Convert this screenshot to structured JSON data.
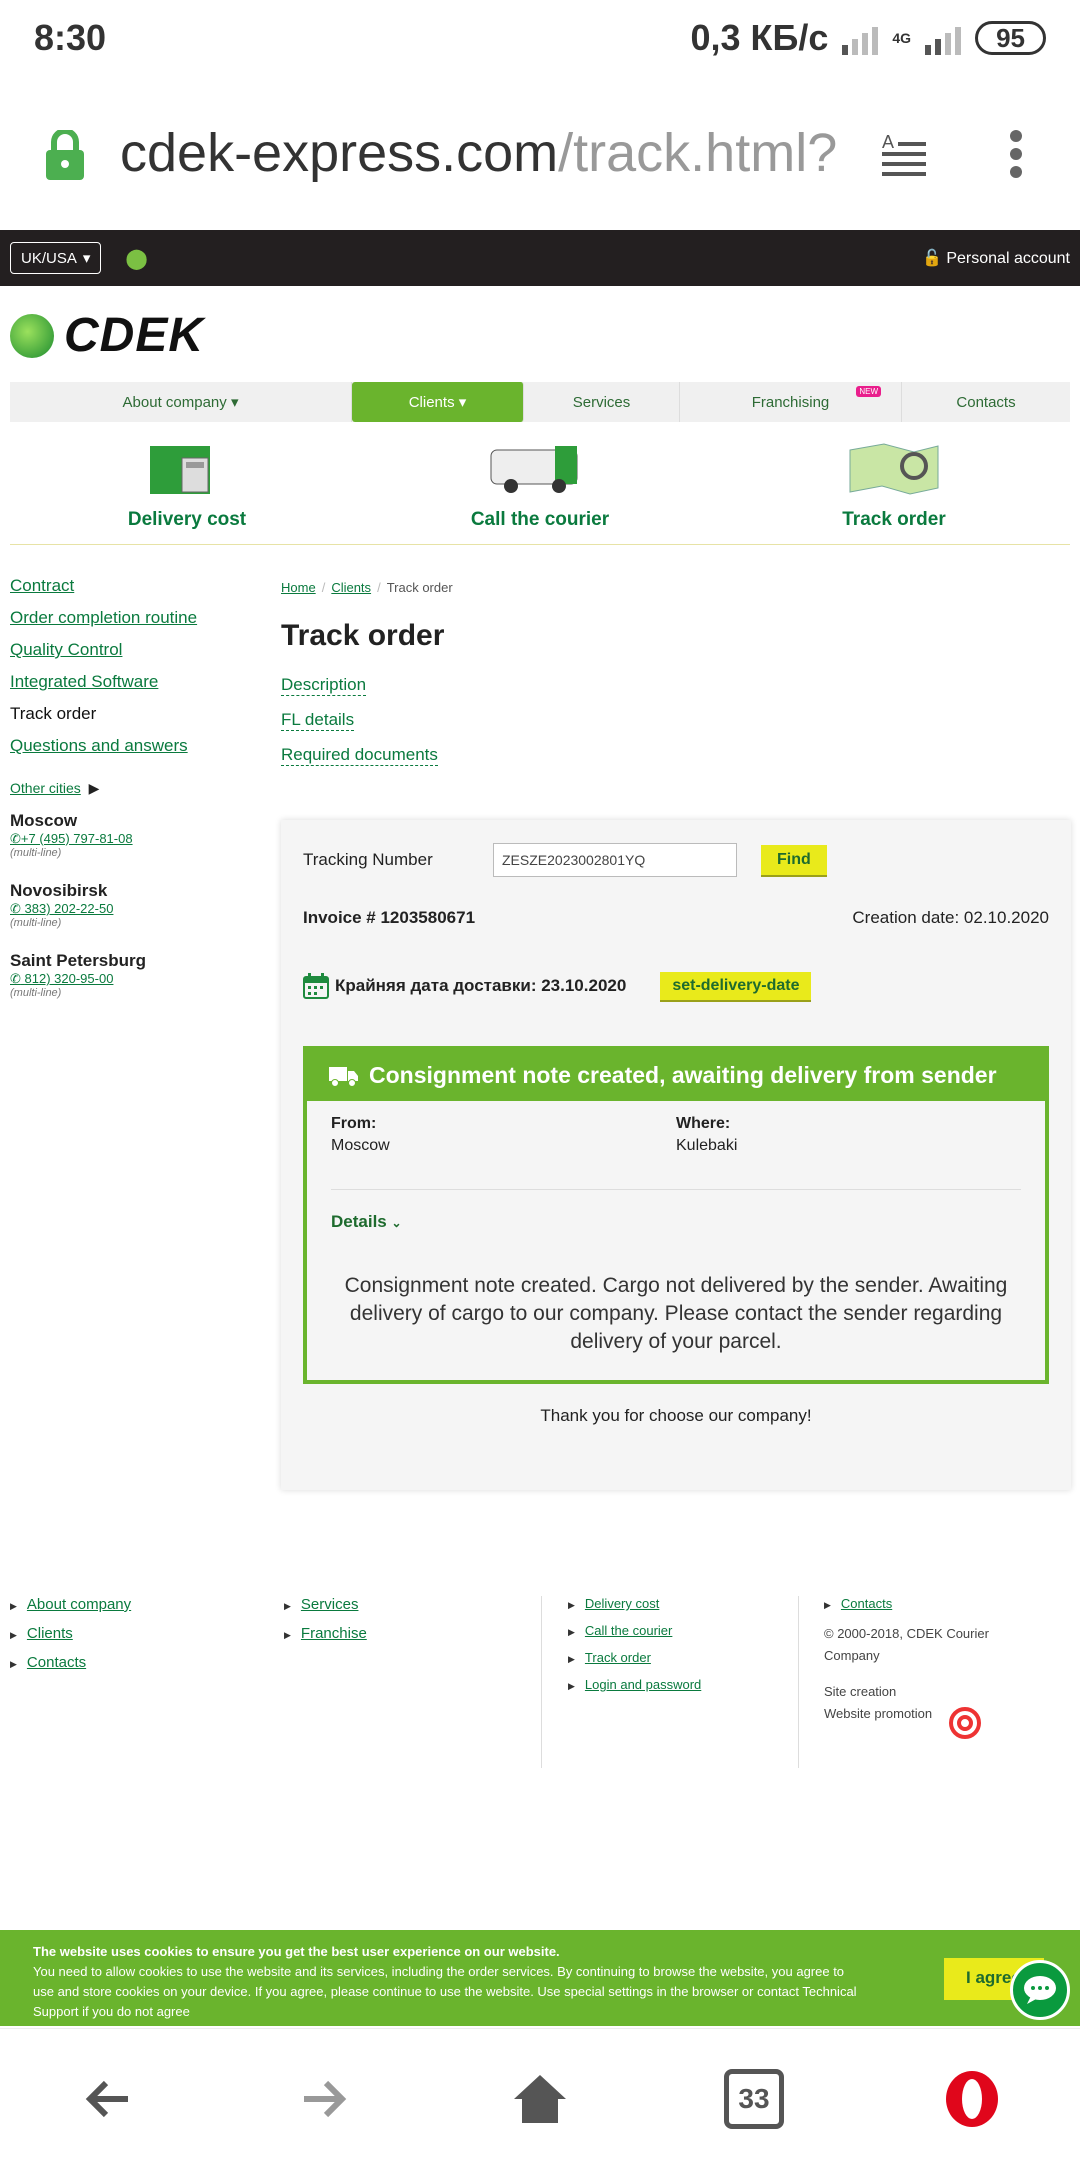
{
  "status_bar": {
    "time": "8:30",
    "speed": "0,3 КБ/с",
    "network": "4G",
    "battery": "95"
  },
  "browser": {
    "url_main": "cdek-express.com",
    "url_path": "/track.html?",
    "tab_count": "33"
  },
  "topbar": {
    "region": "UK/USA",
    "account": "Personal account"
  },
  "logo": {
    "text": "CDEK"
  },
  "mainnav": [
    {
      "label": "About company",
      "active": false
    },
    {
      "label": "Clients",
      "active": true
    },
    {
      "label": "Services",
      "active": false
    },
    {
      "label": "Franchising",
      "active": false,
      "badge": "NEW"
    },
    {
      "label": "Contacts",
      "active": false
    }
  ],
  "quicklinks": [
    "Delivery cost",
    "Call the courier",
    "Track order"
  ],
  "sidebar": {
    "links": [
      "Contract",
      "Order completion routine",
      "Quality Control",
      "Integrated Software",
      "Track order",
      "Questions and answers"
    ],
    "other_cities": "Other cities",
    "cities": [
      {
        "name": "Moscow",
        "phone": "+7 (495) 797-81-08",
        "note": "(multi-line)"
      },
      {
        "name": "Novosibirsk",
        "phone": "383) 202-22-50",
        "note": "(multi-line)"
      },
      {
        "name": "Saint Petersburg",
        "phone": "812) 320-95-00",
        "note": "(multi-line)"
      }
    ]
  },
  "breadcrumb": [
    "Home",
    "Clients",
    "Track order"
  ],
  "page_title": "Track order",
  "sublinks": [
    "Description",
    "FL details",
    "Required documents"
  ],
  "tracking": {
    "label": "Tracking Number",
    "value": "ZESZE2023002801YQ",
    "find": "Find",
    "invoice": "Invoice # 1203580671",
    "created": "Creation date: 02.10.2020",
    "deadline": "Крайняя дата доставки: 23.10.2020",
    "set_delivery": "set-delivery-date",
    "status_title": "Consignment note created, awaiting delivery from sender",
    "from_label": "From:",
    "from": "Moscow",
    "where_label": "Where:",
    "where": "Kulebaki",
    "details": "Details",
    "message": "Consignment note created. Cargo not delivered by the sender. Awaiting delivery of cargo to our company. Please contact the sender regarding delivery of your parcel.",
    "thanks": "Thank you for choose our company!"
  },
  "footer": {
    "col1": [
      "About company",
      "Clients",
      "Contacts"
    ],
    "col2": [
      "Services",
      "Franchise"
    ],
    "col3": [
      "Delivery cost",
      "Call the courier",
      "Track order",
      "Login and password"
    ],
    "col4_link": "Contacts",
    "copyright": "© 2000-2018, CDEK Courier Company",
    "site_creation": "Site creation",
    "promotion": "Website promotion"
  },
  "cookie": {
    "title": "The website uses cookies to ensure you get the best user experience on our website.",
    "text": "You need to allow cookies to use the website and its services, including the order services. By continuing to browse the website, you agree to use and store cookies on your device. If you agree, please continue to use the website. Use special settings in the browser or contact Technical Support if you do not agree",
    "agree": "I agree"
  },
  "colors": {
    "brand_green": "#6ab42d",
    "link_green": "#0a7a3e",
    "yellow": "#e9ea1b",
    "topbar": "#231f20"
  }
}
